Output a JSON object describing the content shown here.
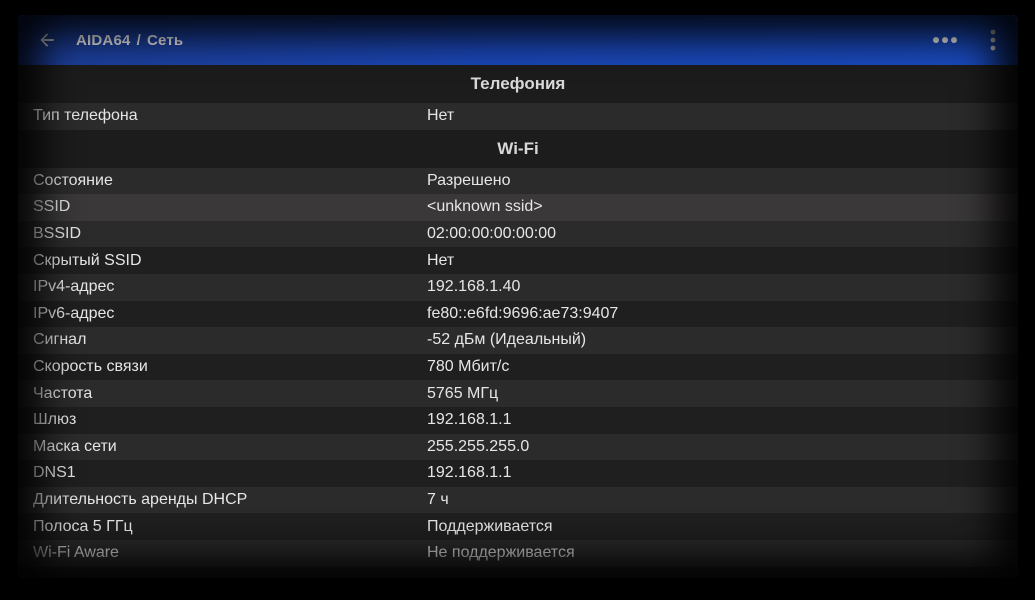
{
  "appbar": {
    "app": "AIDA64",
    "separator": "/",
    "page": "Сеть"
  },
  "icons": {
    "back": "arrow-back-icon",
    "more_horizontal": "more-horizontal-icon",
    "more_vertical": "more-vertical-icon"
  },
  "colors": {
    "appbar": "#1b47b8",
    "background": "#1f1f1f",
    "text": "#e6e6e6"
  },
  "sections": [
    {
      "title": "Телефония",
      "rows": [
        {
          "label": "Тип телефона",
          "value": "Нет"
        }
      ]
    },
    {
      "title": "Wi-Fi",
      "rows": [
        {
          "label": "Состояние",
          "value": "Разрешено"
        },
        {
          "label": "SSID",
          "value": "<unknown ssid>"
        },
        {
          "label": "BSSID",
          "value": "02:00:00:00:00:00"
        },
        {
          "label": "Скрытый SSID",
          "value": "Нет"
        },
        {
          "label": "IPv4-адрес",
          "value": "192.168.1.40"
        },
        {
          "label": "IPv6-адрес",
          "value": "fe80::e6fd:9696:ae73:9407"
        },
        {
          "label": "Сигнал",
          "value": "-52 дБм (Идеальный)"
        },
        {
          "label": "Скорость связи",
          "value": "780 Мбит/с"
        },
        {
          "label": "Частота",
          "value": "5765 МГц"
        },
        {
          "label": "Шлюз",
          "value": "192.168.1.1"
        },
        {
          "label": "Маска сети",
          "value": "255.255.255.0"
        },
        {
          "label": "DNS1",
          "value": "192.168.1.1"
        },
        {
          "label": "Длительность аренды DHCP",
          "value": "7 ч"
        },
        {
          "label": "Полоса 5 ГГц",
          "value": "Поддерживается"
        },
        {
          "label": "Wi-Fi Aware",
          "value": "Не поддерживается"
        }
      ]
    }
  ]
}
